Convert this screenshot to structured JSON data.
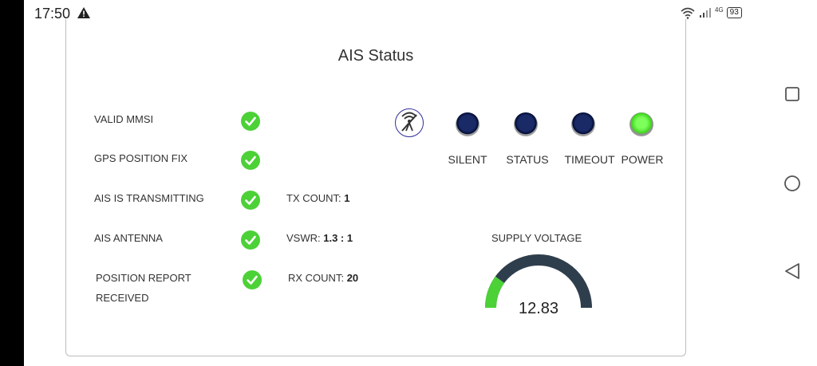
{
  "status_bar": {
    "time": "17:50",
    "network_label": "4G",
    "battery": "93"
  },
  "card": {
    "title": "AIS Status",
    "checks": [
      {
        "label": "VALID MMSI",
        "ok": true
      },
      {
        "label": "GPS POSITION FIX",
        "ok": true
      },
      {
        "label": "AIS IS TRANSMITTING",
        "ok": true
      },
      {
        "label": "AIS ANTENNA",
        "ok": true
      },
      {
        "label": "POSITION REPORT",
        "label_line2": "RECEIVED",
        "ok": true
      }
    ],
    "tx_count": {
      "label": "TX COUNT:",
      "value": "1"
    },
    "vswr": {
      "label": "VSWR:",
      "value": "1.3 : 1"
    },
    "rx_count": {
      "label": "RX COUNT:",
      "value": "20"
    },
    "indicators": [
      {
        "label": "SILENT",
        "state": "off"
      },
      {
        "label": "STATUS",
        "state": "off"
      },
      {
        "label": "TIMEOUT",
        "state": "off"
      },
      {
        "label": "POWER",
        "state": "on"
      }
    ],
    "supply_voltage": {
      "label": "SUPPLY VOLTAGE",
      "value": "12.83",
      "fill_fraction": 0.2
    },
    "icons": {
      "antenna_toggle": "antenna-off-icon",
      "check": "check-circle-icon"
    },
    "colors": {
      "ok": "#4cd137",
      "led_off": "#0b1a52",
      "led_on": "#41d81f",
      "gauge_track": "#2f3e4c",
      "gauge_fill": "#4cd137"
    }
  },
  "nav": {
    "recents": "square-icon",
    "home": "circle-icon",
    "back": "triangle-back-icon"
  }
}
